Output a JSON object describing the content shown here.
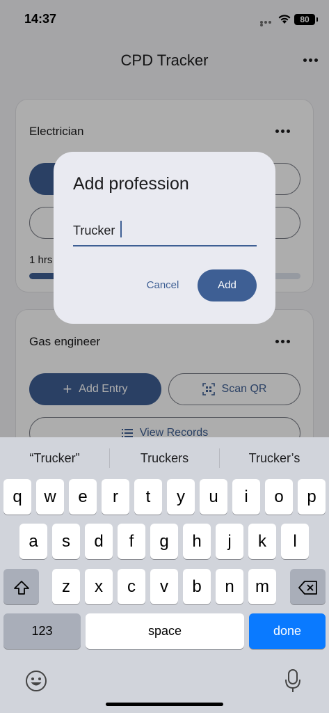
{
  "status_bar": {
    "time": "14:37",
    "battery": "80"
  },
  "app_bar": {
    "title": "CPD Tracker"
  },
  "cards": [
    {
      "title": "Electrician",
      "progress_label": "1 hrs",
      "progress_value": 0.15
    },
    {
      "title": "Gas engineer",
      "add_entry_label": "Add Entry",
      "scan_qr_label": "Scan QR",
      "view_records_label": "View Records"
    }
  ],
  "dialog": {
    "title": "Add profession",
    "input_value": "Trucker",
    "cancel_label": "Cancel",
    "add_label": "Add"
  },
  "keyboard": {
    "suggestions": [
      "“Trucker”",
      "Truckers",
      "Trucker’s"
    ],
    "row1": [
      "q",
      "w",
      "e",
      "r",
      "t",
      "y",
      "u",
      "i",
      "o",
      "p"
    ],
    "row2": [
      "a",
      "s",
      "d",
      "f",
      "g",
      "h",
      "j",
      "k",
      "l"
    ],
    "row3": [
      "z",
      "x",
      "c",
      "v",
      "b",
      "n",
      "m"
    ],
    "numbers_label": "123",
    "space_label": "space",
    "done_label": "done"
  },
  "colors": {
    "accent": "#3e5f94",
    "done_key": "#0a7aff"
  }
}
